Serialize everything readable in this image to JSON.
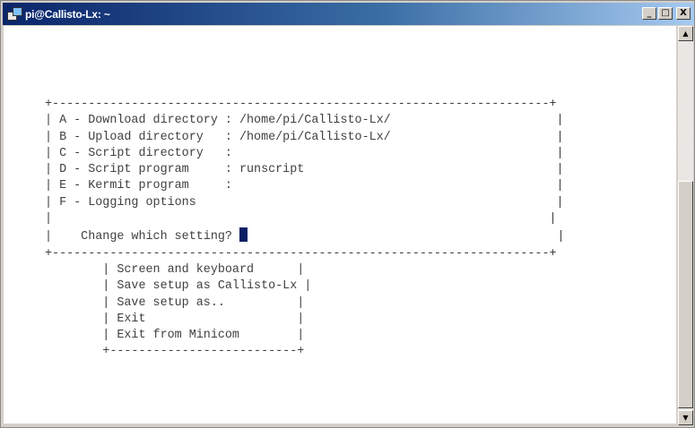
{
  "window": {
    "title": "pi@Callisto-Lx: ~",
    "minimize_label": "_",
    "maximize_label": "□",
    "close_label": "X"
  },
  "terminal": {
    "cursor_color": "#0a1f63",
    "lines": [
      "+---------------------------------------------------------------------+",
      "| A - Download directory : /home/pi/Callisto-Lx/                       |",
      "| B - Upload directory   : /home/pi/Callisto-Lx/                       |",
      "| C - Script directory   :                                             |",
      "| D - Script program     : runscript                                   |",
      "| E - Kermit program     :                                             |",
      "| F - Logging options                                                  |",
      "|                                                                     |",
      "|    Change which setting? ",
      "+---------------------------------------------------------------------+",
      "        | Screen and keyboard      |",
      "        | Save setup as Callisto-Lx |",
      "        | Save setup as..          |",
      "        | Exit                     |",
      "        | Exit from Minicom        |",
      "        +--------------------------+"
    ],
    "prompt_tail": "                                           |"
  },
  "scrollbar": {
    "up_arrow": "▲",
    "down_arrow": "▼"
  }
}
